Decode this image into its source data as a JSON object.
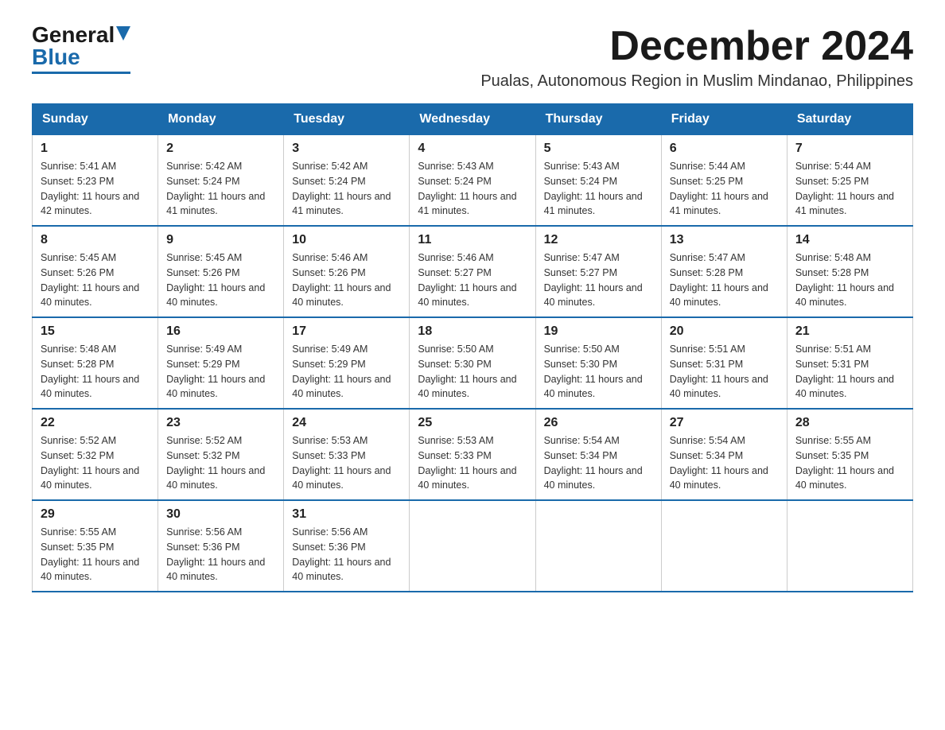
{
  "logo": {
    "general": "General",
    "blue": "Blue"
  },
  "title": "December 2024",
  "subtitle": "Pualas, Autonomous Region in Muslim Mindanao, Philippines",
  "days_of_week": [
    "Sunday",
    "Monday",
    "Tuesday",
    "Wednesday",
    "Thursday",
    "Friday",
    "Saturday"
  ],
  "weeks": [
    [
      {
        "day": "1",
        "sunrise": "5:41 AM",
        "sunset": "5:23 PM",
        "daylight": "11 hours and 42 minutes."
      },
      {
        "day": "2",
        "sunrise": "5:42 AM",
        "sunset": "5:24 PM",
        "daylight": "11 hours and 41 minutes."
      },
      {
        "day": "3",
        "sunrise": "5:42 AM",
        "sunset": "5:24 PM",
        "daylight": "11 hours and 41 minutes."
      },
      {
        "day": "4",
        "sunrise": "5:43 AM",
        "sunset": "5:24 PM",
        "daylight": "11 hours and 41 minutes."
      },
      {
        "day": "5",
        "sunrise": "5:43 AM",
        "sunset": "5:24 PM",
        "daylight": "11 hours and 41 minutes."
      },
      {
        "day": "6",
        "sunrise": "5:44 AM",
        "sunset": "5:25 PM",
        "daylight": "11 hours and 41 minutes."
      },
      {
        "day": "7",
        "sunrise": "5:44 AM",
        "sunset": "5:25 PM",
        "daylight": "11 hours and 41 minutes."
      }
    ],
    [
      {
        "day": "8",
        "sunrise": "5:45 AM",
        "sunset": "5:26 PM",
        "daylight": "11 hours and 40 minutes."
      },
      {
        "day": "9",
        "sunrise": "5:45 AM",
        "sunset": "5:26 PM",
        "daylight": "11 hours and 40 minutes."
      },
      {
        "day": "10",
        "sunrise": "5:46 AM",
        "sunset": "5:26 PM",
        "daylight": "11 hours and 40 minutes."
      },
      {
        "day": "11",
        "sunrise": "5:46 AM",
        "sunset": "5:27 PM",
        "daylight": "11 hours and 40 minutes."
      },
      {
        "day": "12",
        "sunrise": "5:47 AM",
        "sunset": "5:27 PM",
        "daylight": "11 hours and 40 minutes."
      },
      {
        "day": "13",
        "sunrise": "5:47 AM",
        "sunset": "5:28 PM",
        "daylight": "11 hours and 40 minutes."
      },
      {
        "day": "14",
        "sunrise": "5:48 AM",
        "sunset": "5:28 PM",
        "daylight": "11 hours and 40 minutes."
      }
    ],
    [
      {
        "day": "15",
        "sunrise": "5:48 AM",
        "sunset": "5:28 PM",
        "daylight": "11 hours and 40 minutes."
      },
      {
        "day": "16",
        "sunrise": "5:49 AM",
        "sunset": "5:29 PM",
        "daylight": "11 hours and 40 minutes."
      },
      {
        "day": "17",
        "sunrise": "5:49 AM",
        "sunset": "5:29 PM",
        "daylight": "11 hours and 40 minutes."
      },
      {
        "day": "18",
        "sunrise": "5:50 AM",
        "sunset": "5:30 PM",
        "daylight": "11 hours and 40 minutes."
      },
      {
        "day": "19",
        "sunrise": "5:50 AM",
        "sunset": "5:30 PM",
        "daylight": "11 hours and 40 minutes."
      },
      {
        "day": "20",
        "sunrise": "5:51 AM",
        "sunset": "5:31 PM",
        "daylight": "11 hours and 40 minutes."
      },
      {
        "day": "21",
        "sunrise": "5:51 AM",
        "sunset": "5:31 PM",
        "daylight": "11 hours and 40 minutes."
      }
    ],
    [
      {
        "day": "22",
        "sunrise": "5:52 AM",
        "sunset": "5:32 PM",
        "daylight": "11 hours and 40 minutes."
      },
      {
        "day": "23",
        "sunrise": "5:52 AM",
        "sunset": "5:32 PM",
        "daylight": "11 hours and 40 minutes."
      },
      {
        "day": "24",
        "sunrise": "5:53 AM",
        "sunset": "5:33 PM",
        "daylight": "11 hours and 40 minutes."
      },
      {
        "day": "25",
        "sunrise": "5:53 AM",
        "sunset": "5:33 PM",
        "daylight": "11 hours and 40 minutes."
      },
      {
        "day": "26",
        "sunrise": "5:54 AM",
        "sunset": "5:34 PM",
        "daylight": "11 hours and 40 minutes."
      },
      {
        "day": "27",
        "sunrise": "5:54 AM",
        "sunset": "5:34 PM",
        "daylight": "11 hours and 40 minutes."
      },
      {
        "day": "28",
        "sunrise": "5:55 AM",
        "sunset": "5:35 PM",
        "daylight": "11 hours and 40 minutes."
      }
    ],
    [
      {
        "day": "29",
        "sunrise": "5:55 AM",
        "sunset": "5:35 PM",
        "daylight": "11 hours and 40 minutes."
      },
      {
        "day": "30",
        "sunrise": "5:56 AM",
        "sunset": "5:36 PM",
        "daylight": "11 hours and 40 minutes."
      },
      {
        "day": "31",
        "sunrise": "5:56 AM",
        "sunset": "5:36 PM",
        "daylight": "11 hours and 40 minutes."
      },
      null,
      null,
      null,
      null
    ]
  ]
}
